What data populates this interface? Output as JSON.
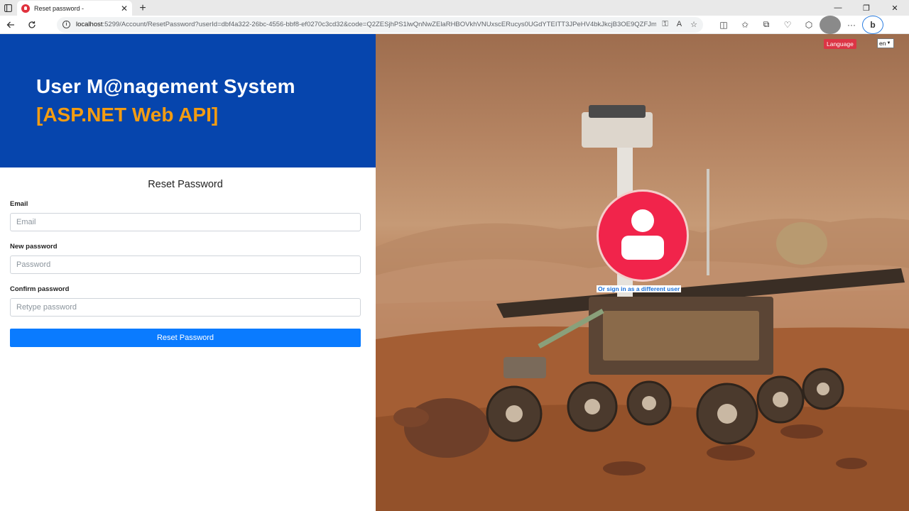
{
  "browser": {
    "tab_title": "Reset password -",
    "url_host": "localhost",
    "url_rest": ":5299/Account/ResetPassword?userId=dbf4a322-26bc-4556-bbf8-ef0270c3cd32&code=Q2ZESjhPS1lwQnNwZElaRHBOVkhVNUxscERucys0UGdYTEITT3JPeHV4bkJkcjB3OE9QZFJmVWNRVlVZMFh1c...",
    "new_tab_label": "+",
    "close_tab_label": "✕"
  },
  "hero": {
    "title": "User M@nagement System",
    "subtitle": "[ASP.NET Web API]"
  },
  "form": {
    "title": "Reset Password",
    "email_label": "Email",
    "email_placeholder": "Email",
    "new_password_label": "New password",
    "new_password_placeholder": "Password",
    "confirm_password_label": "Confirm password",
    "confirm_password_placeholder": "Retype password",
    "submit_label": "Reset Password"
  },
  "side": {
    "language_button": "Language",
    "language_value": "en",
    "signin_link": "Or sign in as a different user"
  },
  "colors": {
    "hero_bg": "#0645ad",
    "hero_subtitle": "#f39c12",
    "primary_button": "#0a7bff",
    "avatar": "#f1244b",
    "language_button": "#dc3545"
  },
  "icons": [
    "sidebar-icon",
    "back-arrow-icon",
    "refresh-icon",
    "info-icon",
    "read-aloud-icon",
    "favorite-star-icon",
    "split-screen-icon",
    "favorites-icon",
    "collections-icon",
    "extensions-icon",
    "profile-icon",
    "more-icon",
    "bing-icon",
    "user-icon"
  ]
}
